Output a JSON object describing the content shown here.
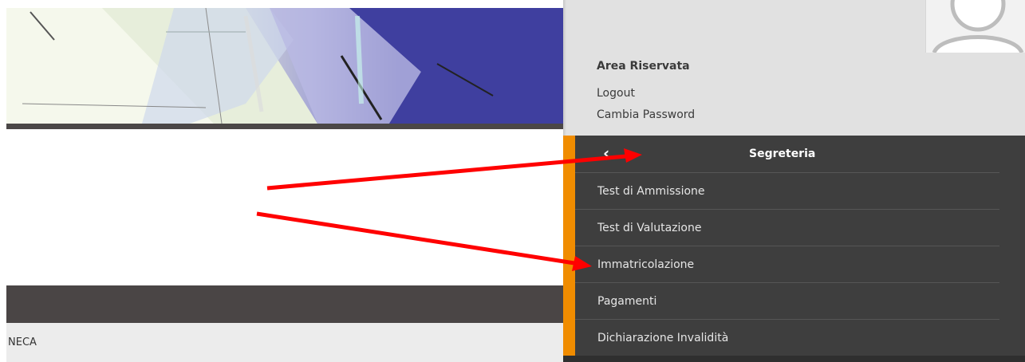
{
  "panel": {
    "area_title": "Area Riservata",
    "logout": "Logout",
    "change_password": "Cambia Password"
  },
  "menu": {
    "title": "Segreteria",
    "items": [
      {
        "label": "Test di Ammissione"
      },
      {
        "label": "Test di Valutazione"
      },
      {
        "label": "Immatricolazione"
      },
      {
        "label": "Pagamenti"
      },
      {
        "label": "Dichiarazione Invalidità"
      }
    ]
  },
  "footer": {
    "text": "NECA"
  },
  "icons": {
    "back": "chevron-left-icon",
    "avatar": "user-avatar-icon",
    "annotation": "red-arrow-icon"
  },
  "colors": {
    "accent": "#f08c00",
    "menu_bg": "#3e3e3e",
    "panel_bg": "#e1e1e1",
    "annotation_arrow": "#ff0000"
  }
}
